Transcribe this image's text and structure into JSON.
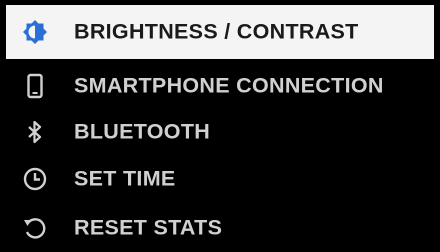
{
  "menu": {
    "items": [
      {
        "label": "BRIGHTNESS / CONTRAST",
        "icon": "brightness-icon",
        "selected": true
      },
      {
        "label": "SMARTPHONE CONNECTION",
        "icon": "smartphone-icon",
        "selected": false
      },
      {
        "label": "BLUETOOTH",
        "icon": "bluetooth-icon",
        "selected": false
      },
      {
        "label": "SET TIME",
        "icon": "clock-icon",
        "selected": false
      },
      {
        "label": "RESET STATS",
        "icon": "reset-icon",
        "selected": false
      }
    ],
    "colors": {
      "background": "#000000",
      "selected_background": "#f4f4f4",
      "selected_text": "#1a1a1a",
      "text": "#d0d0d0",
      "icon_accent": "#2a6fd6"
    }
  }
}
